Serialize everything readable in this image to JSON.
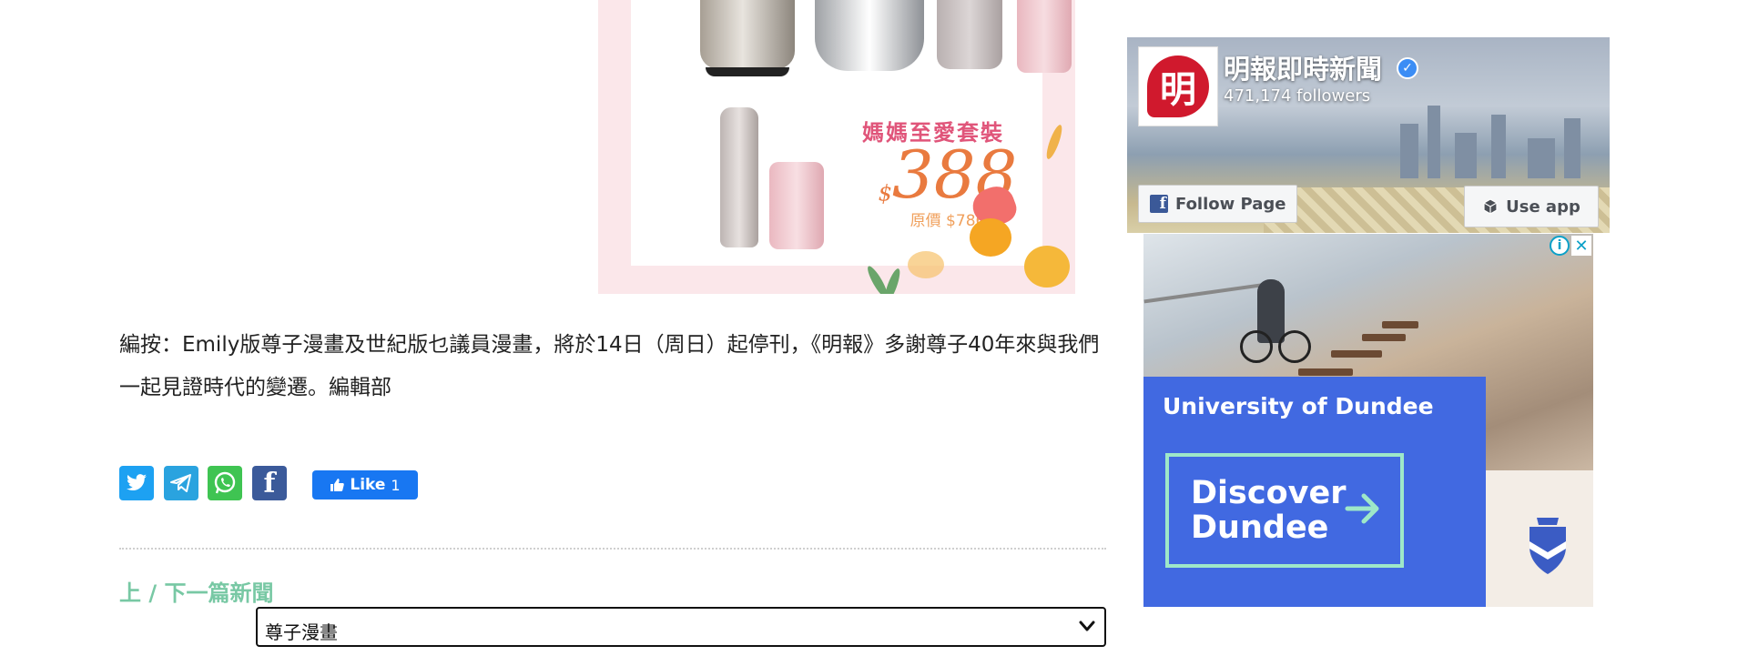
{
  "product_ad": {
    "promo_title": "媽媽至愛套裝",
    "currency": "$",
    "price": "388",
    "original_price": "原價 $786"
  },
  "article": {
    "editor_note": "編按：Emily版尊子漫畫及世紀版乜議員漫畫，將於14日（周日）起停刊，《明報》多謝尊子40年來與我們一起見證時代的變遷。編輯部"
  },
  "share": {
    "facebook_letter": "f",
    "like_label": "Like",
    "like_count": "1",
    "colors": {
      "twitter": "#1da1f2",
      "telegram": "#2aa3df",
      "whatsapp": "#3fc452",
      "facebook": "#3b5a9a",
      "like": "#1877f2"
    }
  },
  "nav": {
    "heading": "上 / 下一篇新聞",
    "select_value": "尊子漫畫"
  },
  "fb_widget": {
    "logo_char": "明",
    "page_name": "明報即時新聞",
    "followers": "471,174 followers",
    "follow_button": "Follow Page",
    "use_app_button": "Use app"
  },
  "uni_ad": {
    "name": "University of Dundee",
    "cta": "Discover\nDundee",
    "brand_color": "#4169e1",
    "cta_border_color": "#9ee8c8"
  },
  "icons": [
    "twitter-icon",
    "telegram-icon",
    "whatsapp-icon",
    "facebook-icon",
    "thumbs-up-icon",
    "chevron-down-icon",
    "verified-icon",
    "cube-icon",
    "arrow-right-icon",
    "adchoices-icon",
    "close-icon",
    "crest-icon"
  ]
}
